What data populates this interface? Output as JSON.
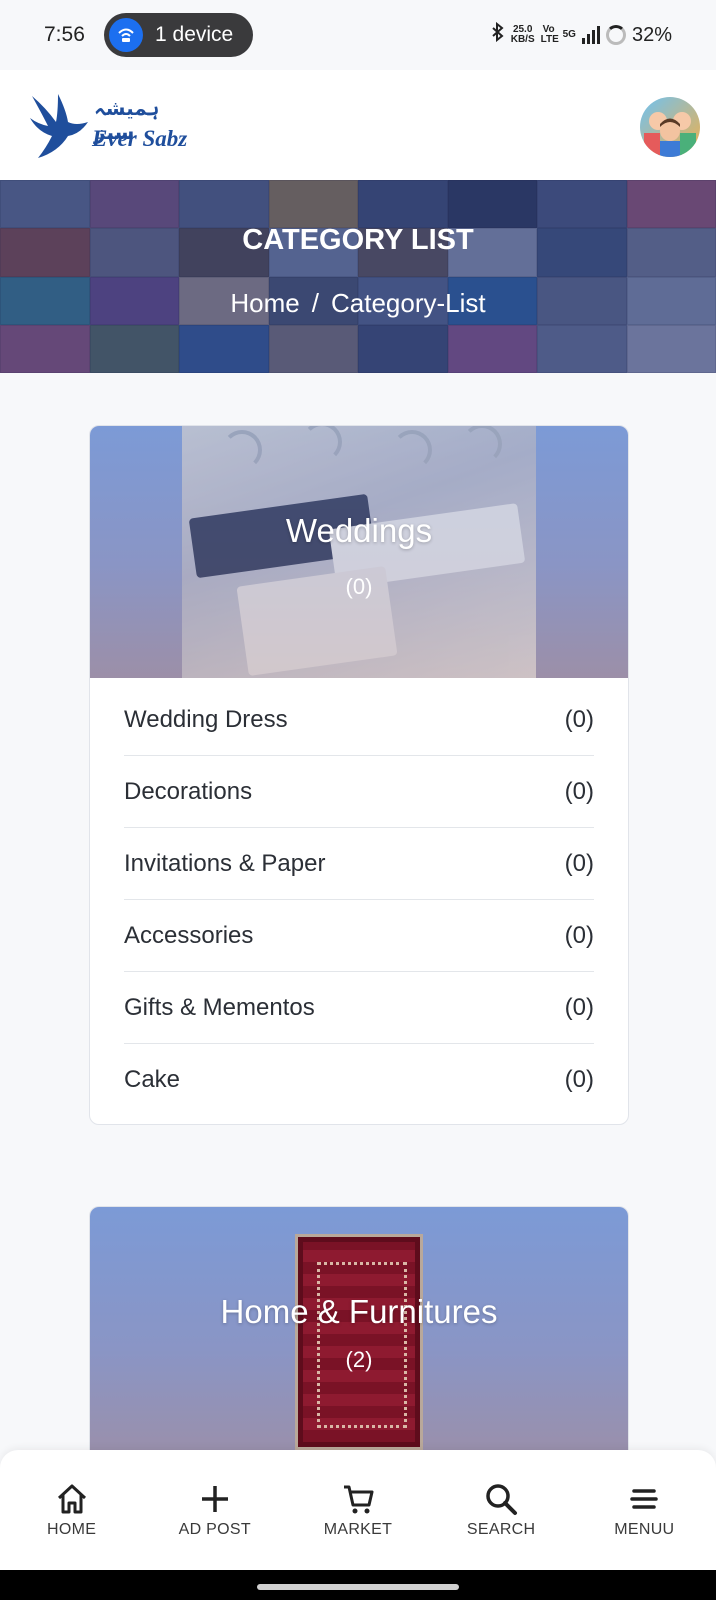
{
  "status": {
    "time": "7:56",
    "device_pill": "1 device",
    "net_speed": "25.0",
    "net_unit": "KB/S",
    "volte": "Vo LTE",
    "network": "5G",
    "battery": "32%"
  },
  "header": {
    "logo_urdu": "ہمیشہ سبز",
    "logo_en": "Ever Sabz"
  },
  "banner": {
    "title": "CATEGORY LIST",
    "breadcrumb_home": "Home",
    "breadcrumb_sep": "/",
    "breadcrumb_current": "Category-List"
  },
  "categories": [
    {
      "title": "Weddings",
      "count": "(0)",
      "items": [
        {
          "label": "Wedding Dress",
          "count": "(0)"
        },
        {
          "label": "Decorations",
          "count": "(0)"
        },
        {
          "label": "Invitations & Paper",
          "count": "(0)"
        },
        {
          "label": "Accessories",
          "count": "(0)"
        },
        {
          "label": "Gifts & Mementos",
          "count": "(0)"
        },
        {
          "label": "Cake",
          "count": "(0)"
        }
      ]
    },
    {
      "title": "Home & Furnitures",
      "count": "(2)"
    }
  ],
  "nav": [
    {
      "label": "HOME",
      "icon": "home-icon"
    },
    {
      "label": "AD POST",
      "icon": "plus-icon"
    },
    {
      "label": "MARKET",
      "icon": "cart-icon"
    },
    {
      "label": "SEARCH",
      "icon": "search-icon"
    },
    {
      "label": "MENUU",
      "icon": "menu-icon"
    }
  ],
  "colors": {
    "brand": "#1f4e9c",
    "banner_overlay": "#28346e",
    "card_gradient_top": "#7c9ad6"
  }
}
